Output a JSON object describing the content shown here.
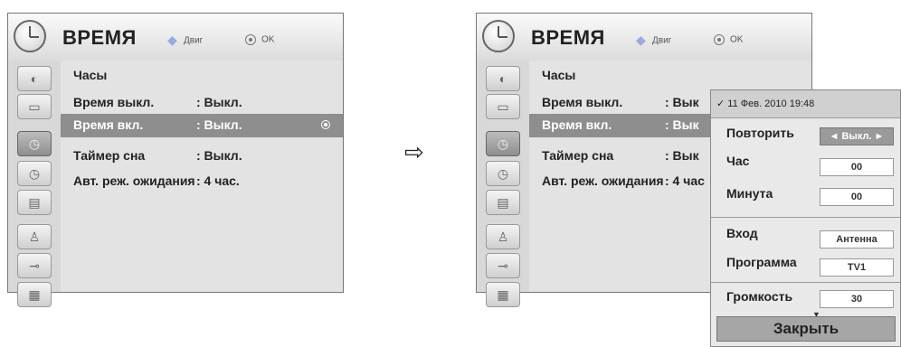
{
  "left_menu": {
    "title": "ВРЕМЯ",
    "hint_move": "Двиг",
    "hint_ok": "OK",
    "items": [
      {
        "label": "Часы",
        "value": ""
      },
      {
        "label": "Время выкл.",
        "value": ": Выкл."
      },
      {
        "label": "Время вкл.",
        "value": ": Выкл."
      },
      {
        "label": "Таймер сна",
        "value": ": Выкл."
      },
      {
        "label": "Авт. реж. ожидания",
        "value": ": 4 час."
      }
    ]
  },
  "arrow": "⇨",
  "right_menu": {
    "title": "ВРЕМЯ",
    "hint_move": "Двиг",
    "hint_ok": "OK",
    "items": [
      {
        "label": "Часы",
        "value": ""
      },
      {
        "label": "Время выкл.",
        "value": ": Вык"
      },
      {
        "label": "Время вкл.",
        "value": ": Вык"
      },
      {
        "label": "Таймер сна",
        "value": ": Вык"
      },
      {
        "label": "Авт. реж. ожидания",
        "value": ": 4 час"
      }
    ]
  },
  "popup": {
    "date": "✓ 11 Фев. 2010 19:48",
    "rows": [
      {
        "label": "Повторить",
        "value": "◄ Выкл. ►"
      },
      {
        "label": "Час",
        "value": "00"
      },
      {
        "label": "Минута",
        "value": "00"
      },
      {
        "label": "Вход",
        "value": "Антенна"
      },
      {
        "label": "Программа",
        "value": "TV1"
      },
      {
        "label": "Громкость",
        "value": "30"
      }
    ],
    "more": "▼",
    "close_label": "Закрыть"
  },
  "icons": [
    "satellite-icon",
    "tv-icon",
    "clock-icon",
    "clock-icon",
    "option-icon",
    "lock-icon",
    "input-icon",
    "usb-icon"
  ]
}
